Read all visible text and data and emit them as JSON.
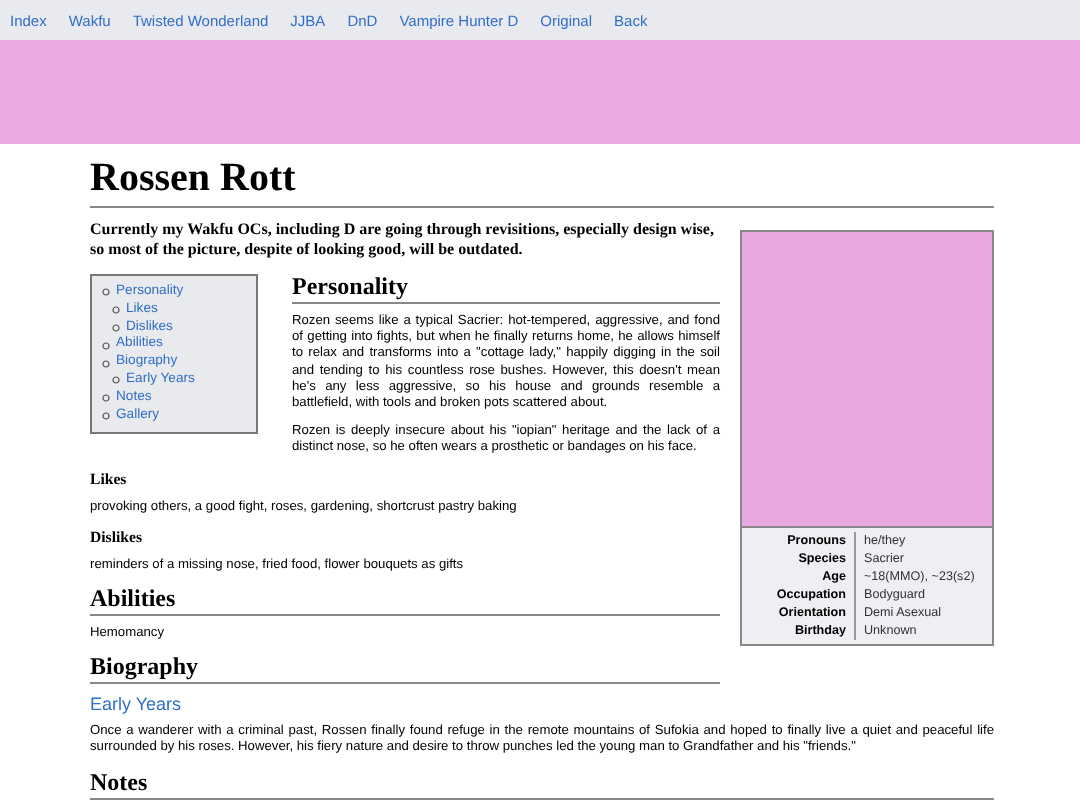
{
  "nav": [
    "Index",
    "Wakfu",
    "Twisted Wonderland",
    "JJBA",
    "DnD",
    "Vampire Hunter D",
    "Original",
    "Back"
  ],
  "title": "Rossen Rott",
  "notice": "Currently my Wakfu OCs, including D are going through revisitions, especially design wise, so most of the picture, despite of looking good, will be outdated.",
  "infobox": [
    {
      "label": "Pronouns",
      "value": "he/they"
    },
    {
      "label": "Species",
      "value": "Sacrier"
    },
    {
      "label": "Age",
      "value": "~18(MMO), ~23(s2)"
    },
    {
      "label": "Occupation",
      "value": "Bodyguard"
    },
    {
      "label": "Orientation",
      "value": "Demi Asexual"
    },
    {
      "label": "Birthday",
      "value": "Unknown"
    }
  ],
  "toc": [
    {
      "label": "Personality",
      "children": [
        {
          "label": "Likes"
        },
        {
          "label": "Dislikes"
        }
      ]
    },
    {
      "label": "Abilities"
    },
    {
      "label": "Biography",
      "children": [
        {
          "label": "Early Years"
        }
      ]
    },
    {
      "label": "Notes"
    },
    {
      "label": "Gallery"
    }
  ],
  "sections": [
    {
      "kind": "h2",
      "text": "Personality"
    },
    {
      "kind": "p",
      "text": "Rozen seems like a typical Sacrier: hot-tempered, aggressive, and fond of getting into fights, but when he finally returns home, he allows himself to relax and transforms into a \"cottage lady,\" happily digging in the soil and tending to his countless rose bushes. However, this doesn't mean he's any less aggressive, so his house and grounds resemble a battlefield, with tools and broken pots scattered about."
    },
    {
      "kind": "p",
      "text": "Rozen is deeply insecure about his \"iopian\" heritage and the lack of a distinct nose, so he often wears a prosthetic or bandages on his face."
    },
    {
      "kind": "h3",
      "text": "Likes"
    },
    {
      "kind": "p",
      "text": "provoking others, a good fight, roses, gardening, shortcrust pastry baking"
    },
    {
      "kind": "h3",
      "text": "Dislikes"
    },
    {
      "kind": "p",
      "text": "reminders of a missing nose, fried food, flower bouquets as gifts"
    },
    {
      "kind": "h2",
      "text": "Abilities"
    },
    {
      "kind": "p",
      "text": "Hemomancy"
    },
    {
      "kind": "h2",
      "text": "Biography"
    },
    {
      "kind": "link",
      "text": "Early Years"
    },
    {
      "kind": "p",
      "text": "Once a wanderer with a criminal past, Rossen finally found refuge in the remote mountains of Sufokia and hoped to finally live a quiet and peaceful life surrounded by his roses. However, his fiery nature and desire to throw punches led the young man to Grandfather and his \"friends.\""
    },
    {
      "kind": "h2",
      "text": "Notes"
    }
  ]
}
